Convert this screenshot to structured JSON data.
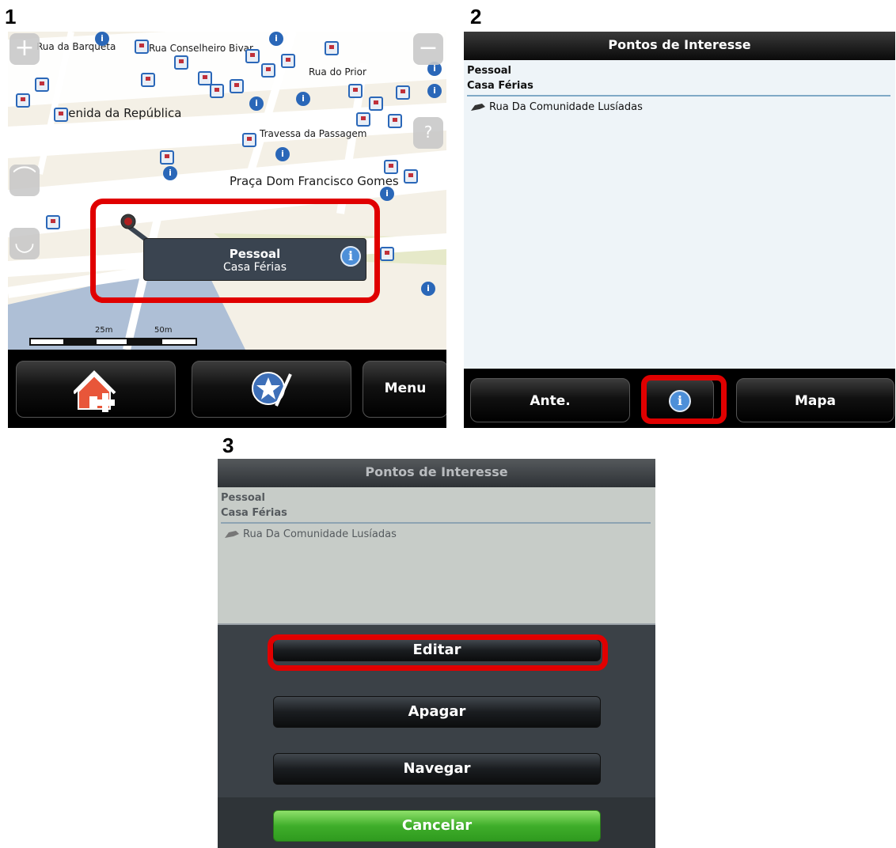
{
  "steps": {
    "s1": "1",
    "s2": "2",
    "s3": "3"
  },
  "map": {
    "streets": {
      "barqueta": "Rua da Barqueta",
      "conselheiro": "Rua Conselheiro Bivar",
      "prior": "Rua do Prior",
      "avenida": "Avenida da República",
      "travessa": "Travessa da Passagem",
      "praca": "Praça Dom Francisco Gomes"
    },
    "scale": {
      "s1": "25m",
      "s2": "50m"
    },
    "popup": {
      "category": "Pessoal",
      "name": "Casa Férias"
    },
    "bottom": {
      "menu": "Menu"
    },
    "icons": [
      "zoom-in-icon",
      "zoom-out-icon",
      "rotate-icon",
      "tilt-icon",
      "info-icon",
      "add-home-icon",
      "favorites-icon"
    ]
  },
  "poi_screen": {
    "title": "Pontos de Interesse",
    "category": "Pessoal",
    "name": "Casa Férias",
    "address": "Rua Da Comunidade Lusíadas",
    "buttons": {
      "prev": "Ante.",
      "map": "Mapa"
    }
  },
  "dialog": {
    "title": "Pontos de Interesse",
    "category": "Pessoal",
    "name": "Casa Férias",
    "address": "Rua Da Comunidade Lusíadas",
    "buttons": {
      "edit": "Editar",
      "delete": "Apagar",
      "navigate": "Navegar",
      "cancel": "Cancelar"
    }
  },
  "colors": {
    "highlight": "#e00000",
    "accent_blue": "#2a67b8",
    "cancel_green": "#3fae2a"
  }
}
